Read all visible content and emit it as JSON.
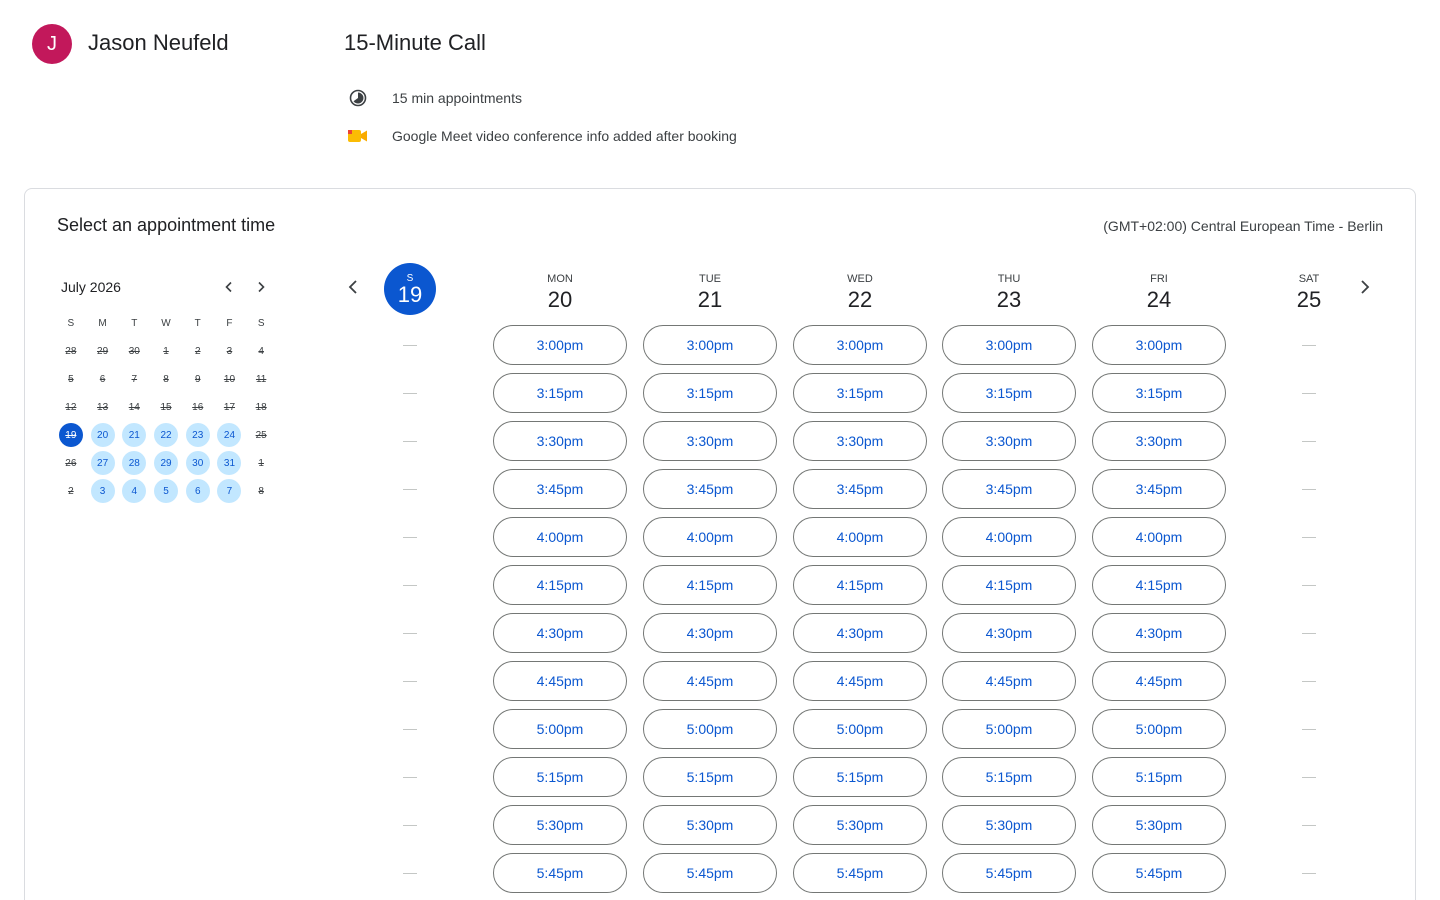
{
  "host": {
    "initial": "J",
    "name": "Jason Neufeld",
    "avatar_color": "#c2185b"
  },
  "event": {
    "title": "15-Minute Call",
    "duration_label": "15 min appointments",
    "duration_icon": "clock-icon",
    "conference_label": "Google Meet video conference info added after booking",
    "conference_icon": "google-meet-icon"
  },
  "booking": {
    "title": "Select an appointment time",
    "timezone": "(GMT+02:00) Central European Time - Berlin"
  },
  "mini_calendar": {
    "month_label": "July 2026",
    "prev_icon": "chevron-left-icon",
    "next_icon": "chevron-right-icon",
    "weekdays": [
      "S",
      "M",
      "T",
      "W",
      "T",
      "F",
      "S"
    ],
    "weeks": [
      [
        {
          "d": "28",
          "s": "past"
        },
        {
          "d": "29",
          "s": "past"
        },
        {
          "d": "30",
          "s": "past"
        },
        {
          "d": "1",
          "s": "past"
        },
        {
          "d": "2",
          "s": "past"
        },
        {
          "d": "3",
          "s": "past"
        },
        {
          "d": "4",
          "s": "past"
        }
      ],
      [
        {
          "d": "5",
          "s": "past"
        },
        {
          "d": "6",
          "s": "past"
        },
        {
          "d": "7",
          "s": "past"
        },
        {
          "d": "8",
          "s": "past"
        },
        {
          "d": "9",
          "s": "past"
        },
        {
          "d": "10",
          "s": "past"
        },
        {
          "d": "11",
          "s": "past"
        }
      ],
      [
        {
          "d": "12",
          "s": "past"
        },
        {
          "d": "13",
          "s": "past"
        },
        {
          "d": "14",
          "s": "past"
        },
        {
          "d": "15",
          "s": "past"
        },
        {
          "d": "16",
          "s": "past"
        },
        {
          "d": "17",
          "s": "past"
        },
        {
          "d": "18",
          "s": "past"
        }
      ],
      [
        {
          "d": "19",
          "s": "selected"
        },
        {
          "d": "20",
          "s": "avail"
        },
        {
          "d": "21",
          "s": "avail"
        },
        {
          "d": "22",
          "s": "avail"
        },
        {
          "d": "23",
          "s": "avail"
        },
        {
          "d": "24",
          "s": "avail"
        },
        {
          "d": "25",
          "s": "past"
        }
      ],
      [
        {
          "d": "26",
          "s": "past"
        },
        {
          "d": "27",
          "s": "avail"
        },
        {
          "d": "28",
          "s": "avail"
        },
        {
          "d": "29",
          "s": "avail"
        },
        {
          "d": "30",
          "s": "avail"
        },
        {
          "d": "31",
          "s": "avail"
        },
        {
          "d": "1",
          "s": "past"
        }
      ],
      [
        {
          "d": "2",
          "s": "past"
        },
        {
          "d": "3",
          "s": "avail"
        },
        {
          "d": "4",
          "s": "avail"
        },
        {
          "d": "5",
          "s": "avail"
        },
        {
          "d": "6",
          "s": "avail"
        },
        {
          "d": "7",
          "s": "avail"
        },
        {
          "d": "8",
          "s": "past"
        }
      ]
    ]
  },
  "week": {
    "prev_icon": "chevron-left-icon",
    "next_icon": "chevron-right-icon",
    "days": [
      {
        "dow": "S",
        "num": "19",
        "today": true,
        "slots": []
      },
      {
        "dow": "MON",
        "num": "20",
        "today": false,
        "slots": [
          "3:00pm",
          "3:15pm",
          "3:30pm",
          "3:45pm",
          "4:00pm",
          "4:15pm",
          "4:30pm",
          "4:45pm",
          "5:00pm",
          "5:15pm",
          "5:30pm",
          "5:45pm"
        ]
      },
      {
        "dow": "TUE",
        "num": "21",
        "today": false,
        "slots": [
          "3:00pm",
          "3:15pm",
          "3:30pm",
          "3:45pm",
          "4:00pm",
          "4:15pm",
          "4:30pm",
          "4:45pm",
          "5:00pm",
          "5:15pm",
          "5:30pm",
          "5:45pm"
        ]
      },
      {
        "dow": "WED",
        "num": "22",
        "today": false,
        "slots": [
          "3:00pm",
          "3:15pm",
          "3:30pm",
          "3:45pm",
          "4:00pm",
          "4:15pm",
          "4:30pm",
          "4:45pm",
          "5:00pm",
          "5:15pm",
          "5:30pm",
          "5:45pm"
        ]
      },
      {
        "dow": "THU",
        "num": "23",
        "today": false,
        "slots": [
          "3:00pm",
          "3:15pm",
          "3:30pm",
          "3:45pm",
          "4:00pm",
          "4:15pm",
          "4:30pm",
          "4:45pm",
          "5:00pm",
          "5:15pm",
          "5:30pm",
          "5:45pm"
        ]
      },
      {
        "dow": "FRI",
        "num": "24",
        "today": false,
        "slots": [
          "3:00pm",
          "3:15pm",
          "3:30pm",
          "3:45pm",
          "4:00pm",
          "4:15pm",
          "4:30pm",
          "4:45pm",
          "5:00pm",
          "5:15pm",
          "5:30pm",
          "5:45pm"
        ]
      },
      {
        "dow": "SAT",
        "num": "25",
        "today": false,
        "slots": []
      }
    ]
  },
  "colors": {
    "accent": "#0b57d0",
    "available_day": "#c2e7ff",
    "border": "#dadce0"
  }
}
